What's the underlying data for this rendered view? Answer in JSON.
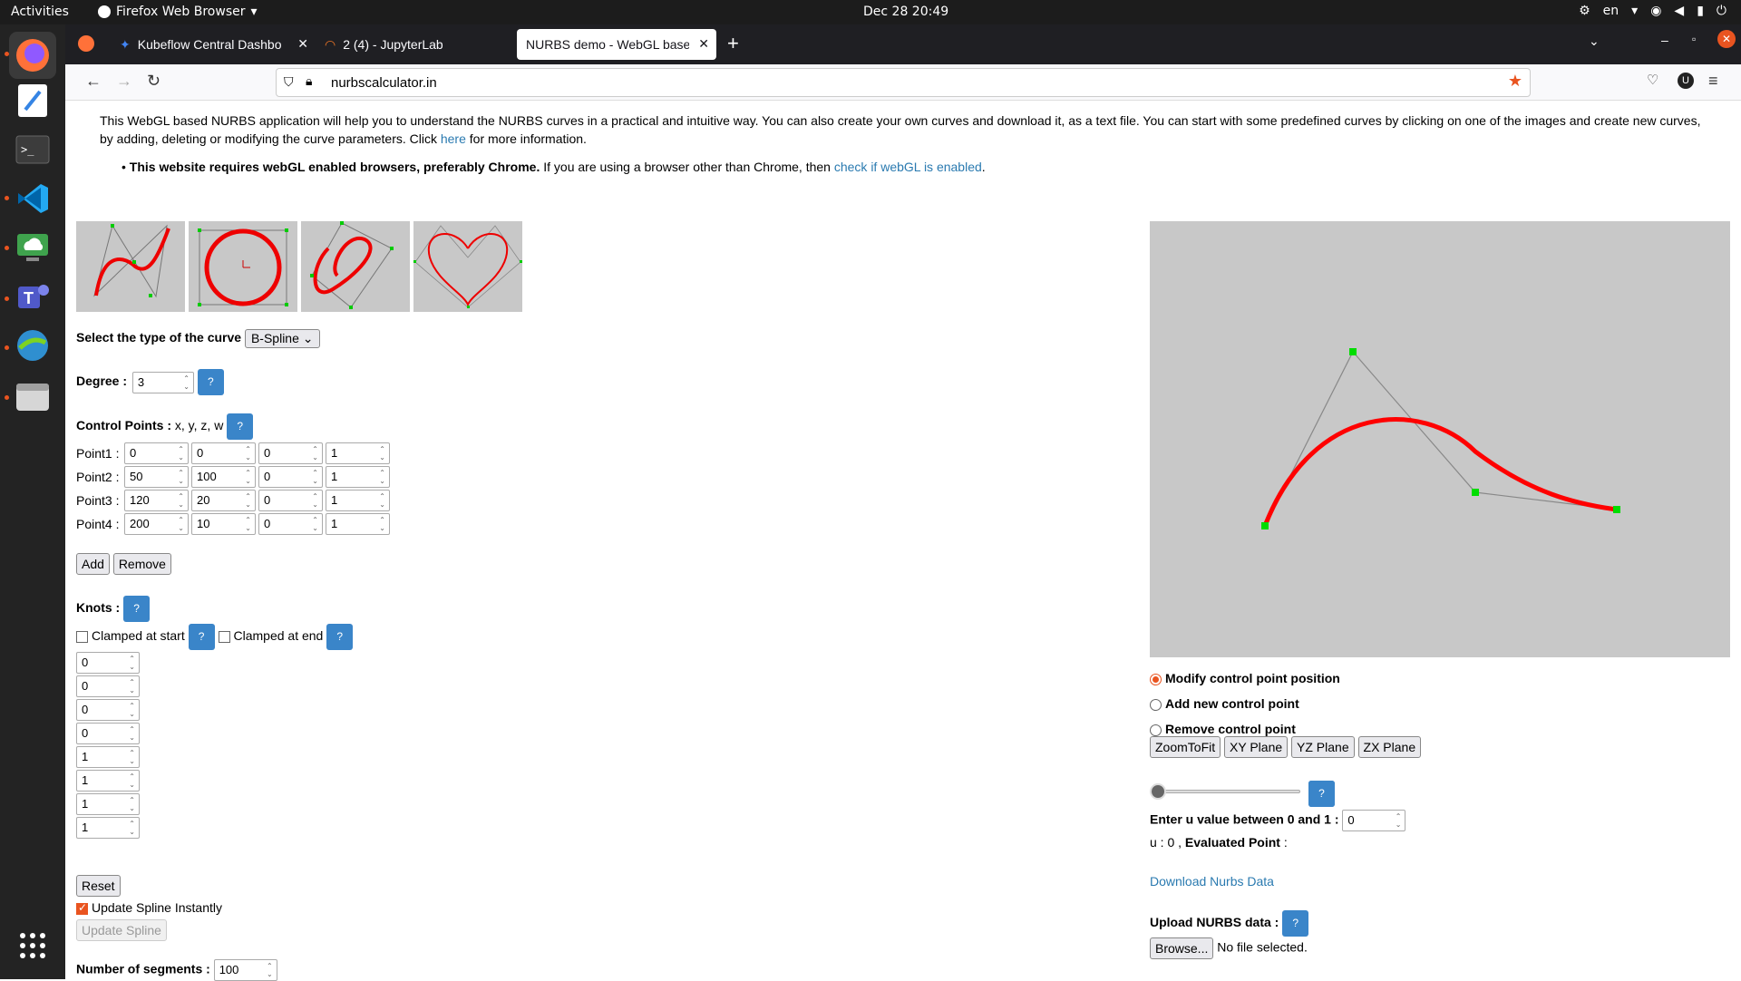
{
  "topbar": {
    "activities": "Activities",
    "app_name": "Firefox Web Browser",
    "clock": "Dec 28  20:49",
    "lang": "en"
  },
  "tabs": [
    {
      "label": "Kubeflow Central Dashbo"
    },
    {
      "label": "2 (4) - JupyterLab"
    },
    {
      "label": "NURBS demo - WebGL based"
    }
  ],
  "nav": {
    "url": "nurbscalculator.in"
  },
  "intro": {
    "text1": "This WebGL based NURBS application will help you to understand the NURBS curves in a practical and intuitive way. You can also create your own curves and download it, as a text file. You can start with some predefined curves by clicking on one of the images and create new curves,",
    "text2": "by adding, deleting or modifying the curve parameters. Click ",
    "here": "here",
    "text3": " for more information.",
    "bullet_bold": "This website requires webGL enabled browsers, preferably Chrome.",
    "bullet_rest": " If you are using a browser other than Chrome, then ",
    "bullet_link": "check if webGL is enabled",
    "bullet_end": "."
  },
  "form": {
    "curve_type_label": "Select the type of the curve",
    "curve_type_value": "B-Spline",
    "degree_label": "Degree :",
    "degree_value": "3",
    "help": "?",
    "cp_label": "Control Points :",
    "cp_hint": " x, y, z, w",
    "points": [
      {
        "name": "Point1 :",
        "x": "0",
        "y": "0",
        "z": "0",
        "w": "1"
      },
      {
        "name": "Point2 :",
        "x": "50",
        "y": "100",
        "z": "0",
        "w": "1"
      },
      {
        "name": "Point3 :",
        "x": "120",
        "y": "20",
        "z": "0",
        "w": "1"
      },
      {
        "name": "Point4 :",
        "x": "200",
        "y": "10",
        "z": "0",
        "w": "1"
      }
    ],
    "add": "Add",
    "remove": "Remove",
    "knots_label": "Knots :",
    "clamped_start": "Clamped at start",
    "clamped_end": "Clamped at end",
    "knots": [
      "0",
      "0",
      "0",
      "0",
      "1",
      "1",
      "1",
      "1"
    ],
    "reset": "Reset",
    "update_instantly": "Update Spline Instantly",
    "update_spline": "Update Spline",
    "segments_label": "Number of segments :",
    "segments_value": "100"
  },
  "viewer": {
    "mode_modify": "Modify control point position",
    "mode_add": "Add new control point",
    "mode_remove": "Remove control point",
    "zoom": "ZoomToFit",
    "xy": "XY Plane",
    "yz": "YZ Plane",
    "zx": "ZX Plane",
    "u_label": "Enter u value between 0 and 1 :",
    "u_value": "0",
    "eval_prefix": "u : 0 , ",
    "eval_label": "Evaluated Point",
    "eval_suffix": " :",
    "download": "Download Nurbs Data",
    "upload_label": "Upload NURBS data :",
    "browse": "Browse...",
    "no_file": "No file selected."
  },
  "colors": {
    "curve": "#ff0000",
    "control": "#00dd00",
    "help_button": "#3a85c9",
    "canvas_bg": "#c8c8c8"
  }
}
